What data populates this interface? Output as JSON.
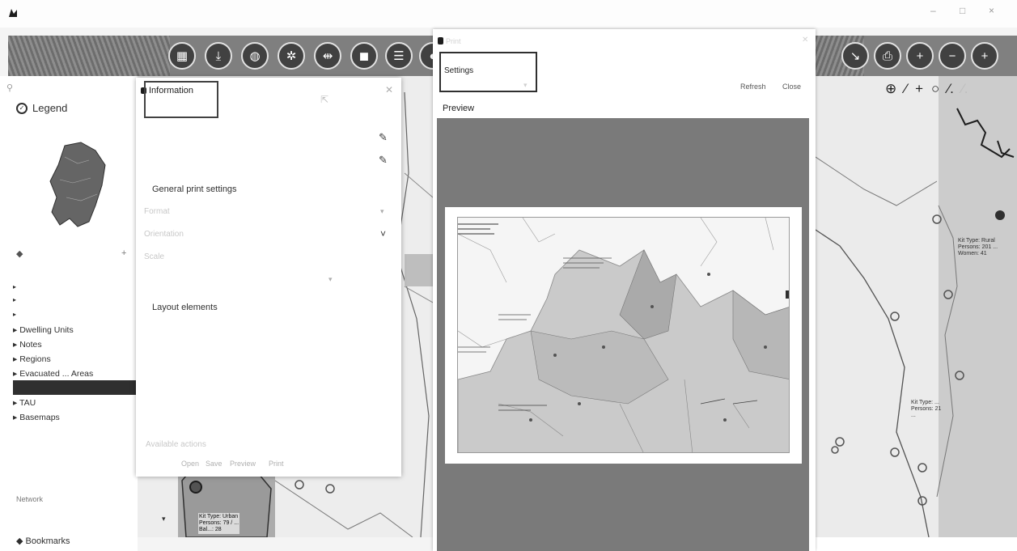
{
  "colors": {
    "toolbar": "#7f7f7f",
    "button": "#444444",
    "highlight": "#333333",
    "print_bg": "#7a7a7a"
  },
  "window": {
    "title": "",
    "user": "",
    "controls": [
      "–",
      "□",
      "×"
    ]
  },
  "toolbar": {
    "buttons": [
      {
        "icon": "print-icon",
        "glyph": "▦"
      },
      {
        "icon": "download-icon",
        "glyph": "⤓"
      },
      {
        "icon": "globe-icon",
        "glyph": "◍"
      },
      {
        "icon": "compass-icon",
        "glyph": "✲"
      },
      {
        "icon": "measure-icon",
        "glyph": "⇹"
      },
      {
        "icon": "layers-icon",
        "glyph": "◼"
      },
      {
        "icon": "list-icon",
        "glyph": "☰"
      },
      {
        "icon": "more-icon",
        "glyph": "◐"
      }
    ],
    "right_buttons": [
      {
        "icon": "tool-icon",
        "glyph": "↘"
      },
      {
        "icon": "printer-icon",
        "glyph": "⎙"
      },
      {
        "icon": "zoom-in-icon",
        "glyph": "+"
      },
      {
        "icon": "zoom-out-icon",
        "glyph": "−"
      },
      {
        "icon": "home-icon",
        "glyph": "+"
      }
    ]
  },
  "sidebar": {
    "search_placeholder": "",
    "legend_title": "Legend",
    "legend_sub": "",
    "layers_label": "",
    "layers": [
      {
        "label": ""
      },
      {
        "label": ""
      },
      {
        "label": ""
      },
      {
        "label": "Dwelling Units"
      },
      {
        "label": "Notes"
      },
      {
        "label": "Regions"
      },
      {
        "label": "Evacuated ... Areas"
      },
      {
        "label": "",
        "selected": true
      },
      {
        "label": "TAU"
      },
      {
        "label": "Basemaps"
      }
    ],
    "bottom_heading": "Network",
    "bottom_item": "Bookmarks"
  },
  "info_dialog": {
    "title": "Information",
    "rows": [
      {
        "label": "",
        "value": ""
      },
      {
        "label": "",
        "value": ""
      }
    ],
    "section_general": "General print settings",
    "fields": [
      {
        "label": "Format",
        "value": ""
      },
      {
        "label": "Orientation",
        "value": ""
      },
      {
        "label": "Scale",
        "value": ""
      },
      {
        "label": "",
        "value": ""
      }
    ],
    "section_layout": "Layout elements",
    "footer_title": "Available actions",
    "footer_actions": [
      "Open",
      "Save",
      "Preview",
      "Print"
    ]
  },
  "print_panel": {
    "header": "Print",
    "subtitle": "",
    "settings_label": "Settings",
    "dropdown": "",
    "refresh": "Refresh",
    "close": "Close",
    "preview": "Preview"
  },
  "map_labels": {
    "popup_left": [
      "Kit Type: Urban",
      "Persons: 79 / ...",
      "Bal...: 28"
    ],
    "popup_right": [
      "Kit Type: Rural",
      "Persons: 201 ...",
      "Women: 41"
    ],
    "popup_right2": [
      "Kit Type: ...",
      "Persons: 21",
      "..."
    ]
  },
  "status_bar": "",
  "draw_tools": [
    "⊕",
    "⁄",
    "+",
    "○",
    "⁄.",
    "⁄."
  ]
}
